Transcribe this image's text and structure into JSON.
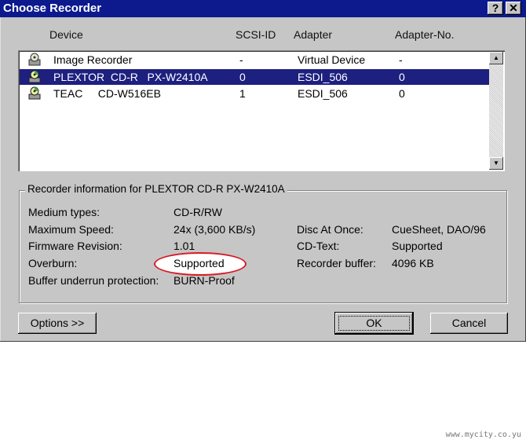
{
  "window": {
    "title": "Choose Recorder",
    "help_glyph": "?",
    "close_glyph": "✕"
  },
  "columns": {
    "device": "Device",
    "scsi_id": "SCSI-ID",
    "adapter": "Adapter",
    "adapter_no": "Adapter-No."
  },
  "devices": [
    {
      "name": "Image Recorder",
      "scsi_id": "-",
      "adapter": "Virtual Device",
      "adapter_no": "-",
      "icon": "image-recorder-icon",
      "selected": false
    },
    {
      "name": "PLEXTOR  CD-R   PX-W2410A",
      "scsi_id": "0",
      "adapter": "ESDI_506",
      "adapter_no": "0",
      "icon": "cd-drive-icon",
      "selected": true
    },
    {
      "name": "TEAC     CD-W516EB",
      "scsi_id": "1",
      "adapter": "ESDI_506",
      "adapter_no": "0",
      "icon": "cd-drive-icon",
      "selected": false
    }
  ],
  "info": {
    "group_title": "Recorder information for PLEXTOR  CD-R   PX-W2410A",
    "medium_types_label": "Medium types:",
    "medium_types_value": "CD-R/RW",
    "max_speed_label": "Maximum Speed:",
    "max_speed_value": "24x (3,600 KB/s)",
    "firmware_label": "Firmware Revision:",
    "firmware_value": "1.01",
    "overburn_label": "Overburn:",
    "overburn_value": "Supported",
    "underrun_label": "Buffer underrun protection:",
    "underrun_value": "BURN-Proof",
    "dao_label": "Disc At Once:",
    "dao_value": "CueSheet, DAO/96",
    "cdtext_label": "CD-Text:",
    "cdtext_value": "Supported",
    "buffer_label": "Recorder buffer:",
    "buffer_value": "4096 KB"
  },
  "buttons": {
    "options": "Options >>",
    "ok": "OK",
    "cancel": "Cancel"
  },
  "watermark": "www.mycity.co.yu",
  "colors": {
    "title_bar": "#0c1a8e",
    "selection": "#1d207f",
    "highlight_oval": "#d81b24",
    "face": "#c6c6c6"
  }
}
